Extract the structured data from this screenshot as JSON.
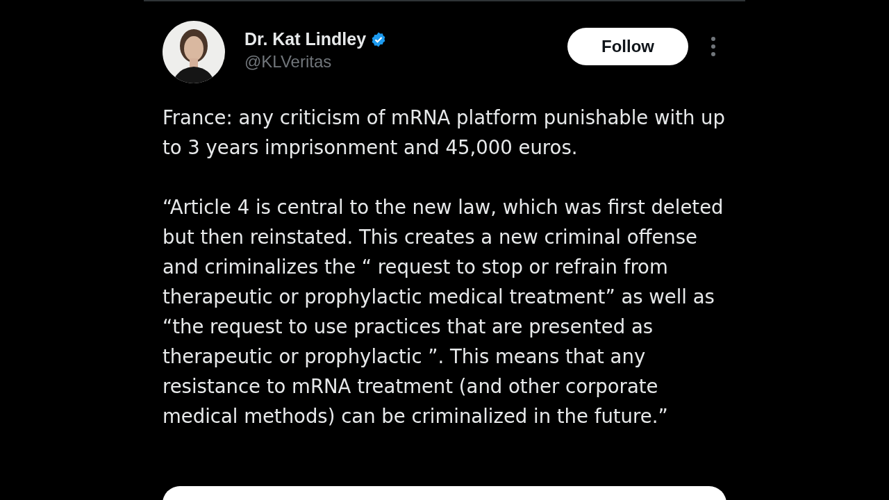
{
  "author": {
    "name": "Dr. Kat Lindley",
    "verified": true,
    "handle": "@KLVeritas"
  },
  "follow_button": "Follow",
  "paragraphs": [
    "France: any criticism of mRNA platform punishable with up to 3 years imprisonment and 45,000 euros.",
    "“Article 4 is central to the new law, which was first deleted but then reinstated. This creates a new criminal offense and criminalizes the “ request to stop or refrain from therapeutic or prophylactic medical treatment” as well as “the request to use practices that are presented as therapeutic or prophylactic ”. This means that any resistance to mRNA treatment (and other corporate medical methods) can be criminalized in the future.”"
  ]
}
